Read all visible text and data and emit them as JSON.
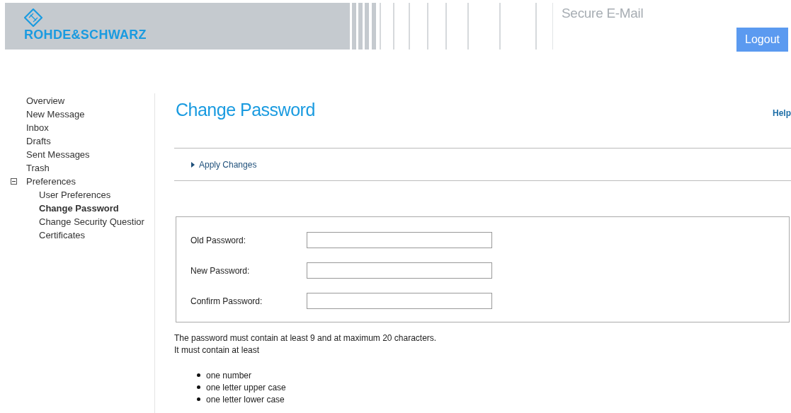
{
  "header": {
    "logo_text": "ROHDE&SCHWARZ",
    "app_title": "Secure E-Mail",
    "logout_button": "Logout"
  },
  "sidebar": {
    "items": [
      {
        "label": "Overview",
        "selected": false
      },
      {
        "label": "New Message",
        "selected": false
      },
      {
        "label": "Inbox",
        "selected": false
      },
      {
        "label": "Drafts",
        "selected": false
      },
      {
        "label": "Sent Messages",
        "selected": false
      },
      {
        "label": "Trash",
        "selected": false
      },
      {
        "label": "Preferences",
        "selected": false,
        "expanded": true,
        "children": [
          {
            "label": "User Preferences",
            "selected": false
          },
          {
            "label": "Change Password",
            "selected": true
          },
          {
            "label": "Change Security Questior",
            "selected": false
          },
          {
            "label": "Certificates",
            "selected": false
          }
        ]
      }
    ]
  },
  "page": {
    "title": "Change Password",
    "help_link": "Help",
    "action": "Apply Changes"
  },
  "form": {
    "fields": [
      {
        "label": "Old Password:"
      },
      {
        "label": "New Password:"
      },
      {
        "label": "Confirm Password:"
      }
    ]
  },
  "rules": {
    "intro": "The password must contain at least 9 and at maximum 20 characters.",
    "lead": "It must contain at least",
    "items": [
      "one number",
      "one letter upper case",
      "one letter lower case"
    ]
  }
}
